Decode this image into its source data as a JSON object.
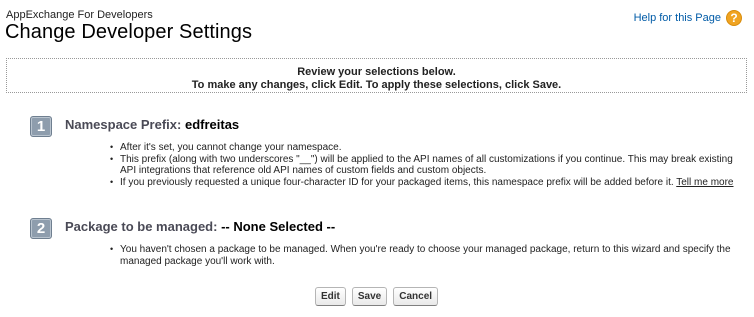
{
  "header": {
    "subtitle": "AppExchange For Developers",
    "title": "Change Developer Settings",
    "help_link": "Help for this Page",
    "help_icon": "?"
  },
  "review": {
    "line1": "Review your selections below.",
    "line2": "To make any changes, click Edit. To apply these selections, click Save."
  },
  "steps": [
    {
      "number": "1",
      "title_label": "Namespace Prefix:",
      "title_value": "edfreitas",
      "bullets": [
        "After it's set, you cannot change your namespace.",
        "This prefix (along with two underscores \"__\") will be applied to the API names of all customizations if you continue. This may break existing API integrations that reference old API names of custom fields and custom objects.",
        "If you previously requested a unique four-character ID for your packaged items, this namespace prefix will be added before it."
      ],
      "link": "Tell me more"
    },
    {
      "number": "2",
      "title_label": "Package to be managed:",
      "title_value": "-- None Selected --",
      "bullets": [
        "You haven't chosen a package to be managed. When you're ready to choose your managed package, return to this wizard and specify the managed package you'll work with."
      ]
    }
  ],
  "buttons": {
    "edit": "Edit",
    "save": "Save",
    "cancel": "Cancel"
  },
  "colors": {
    "link": "#015ba7",
    "help_icon": "#f0a422",
    "step_badge": "#8e9dad"
  }
}
